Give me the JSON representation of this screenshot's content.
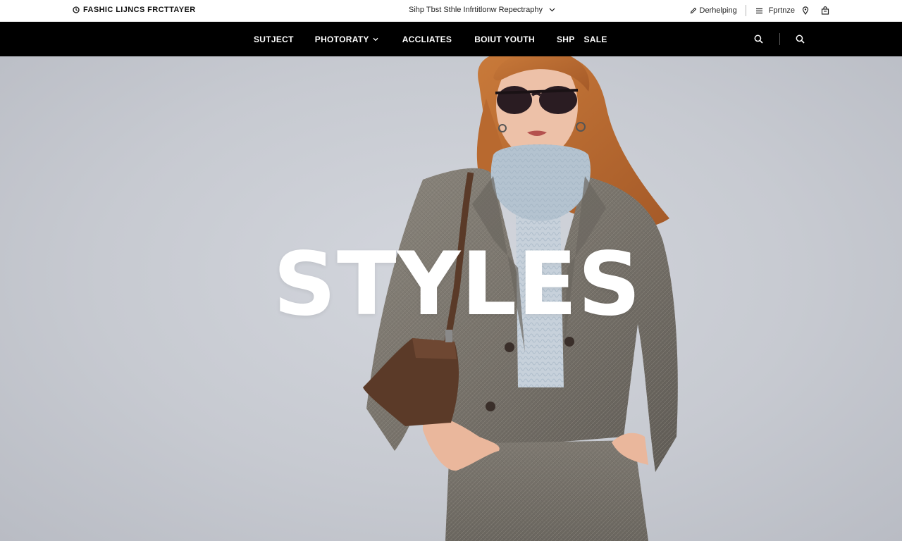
{
  "topbar": {
    "brand_icon": "clock-icon",
    "brand": "FASHIC LIJNCS FRCTTAYER",
    "announcement": "Sihp Tbst Sthle Infrtitlonw Repectraphy",
    "announcement_icon": "chevron-down-icon",
    "help_icon": "pen-icon",
    "help_label": "Derhelping",
    "menu_icon": "stack-icon",
    "menu_label": "Fprtnze",
    "location_icon": "map-pin-icon",
    "bag_icon": "bag-icon"
  },
  "nav": {
    "items": [
      {
        "label": "SUTJECT"
      },
      {
        "label": "PHOTORATY",
        "has_dropdown": true
      },
      {
        "label": "ACCLIATES"
      },
      {
        "label": "BOIUT YOUTH"
      },
      {
        "label": "SHP"
      },
      {
        "label": "SALE"
      }
    ],
    "icons": [
      "search-icon",
      "search-icon"
    ]
  },
  "hero": {
    "title": "STYLES"
  },
  "colors": {
    "nav_background": "#000000",
    "topbar_background": "#ffffff",
    "hero_background": "#c9ccd3",
    "hero_text": "#ffffff"
  }
}
